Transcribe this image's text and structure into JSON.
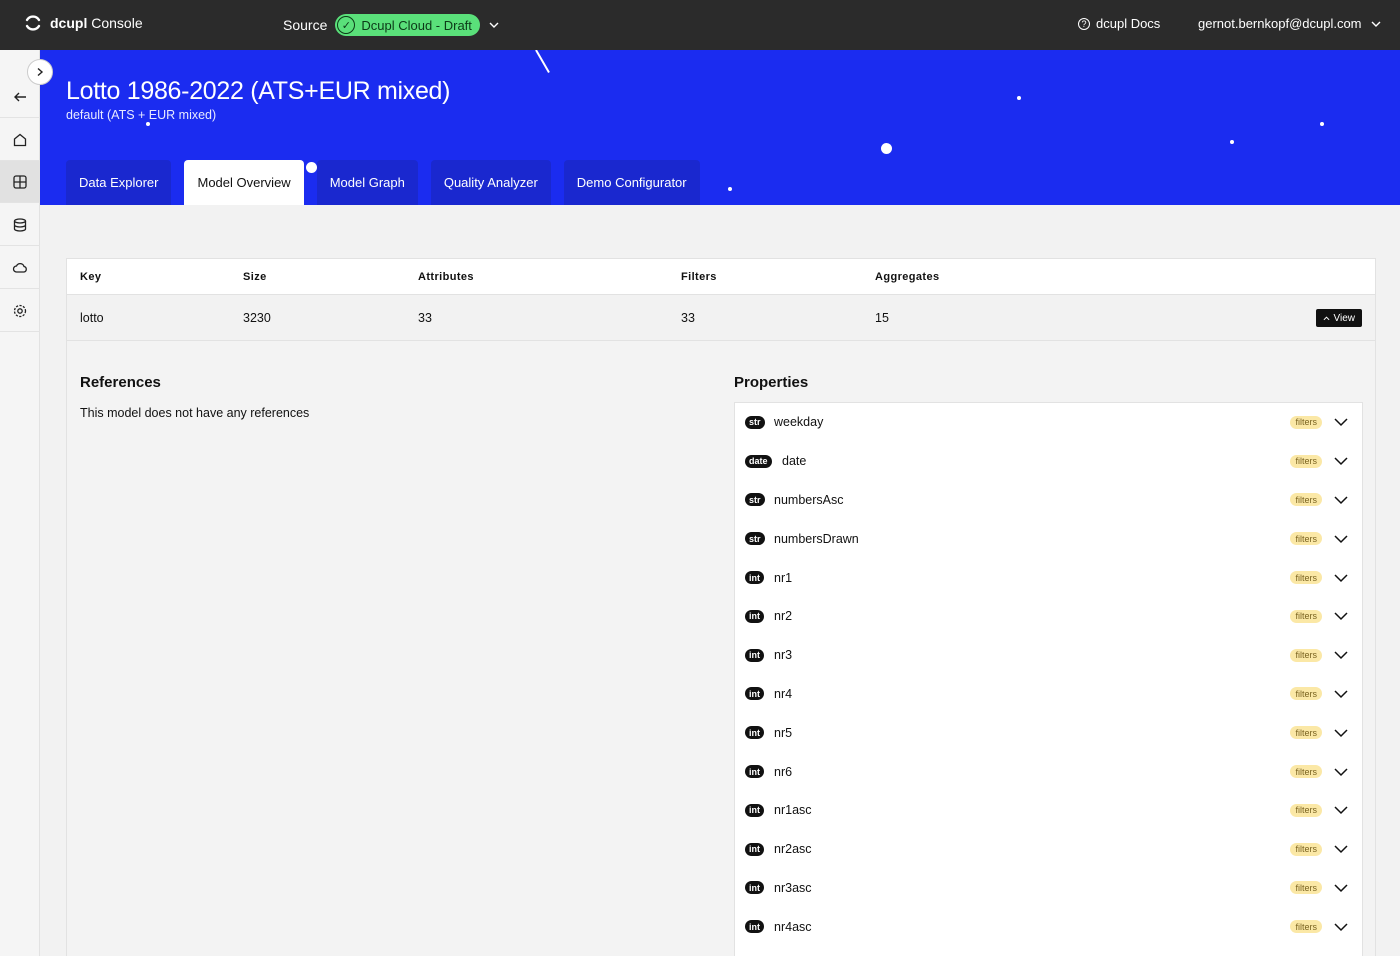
{
  "topbar": {
    "brand_bold": "dcupl",
    "brand_rest": " Console",
    "source_label": "Source",
    "source_value": "Dcupl Cloud - Draft",
    "docs_label": "dcupl Docs",
    "user_email": "gernot.bernkopf@dcupl.com"
  },
  "sidebar": {
    "items": [
      {
        "icon": "arrow-left-icon"
      },
      {
        "icon": "home-icon"
      },
      {
        "icon": "grid-icon"
      },
      {
        "icon": "database-icon"
      },
      {
        "icon": "cloud-icon"
      },
      {
        "icon": "gear-icon"
      }
    ]
  },
  "hero": {
    "title": "Lotto 1986-2022 (ATS+EUR mixed)",
    "subtitle": "default (ATS + EUR mixed)",
    "tabs": [
      {
        "label": "Data Explorer",
        "active": false
      },
      {
        "label": "Model Overview",
        "active": true
      },
      {
        "label": "Model Graph",
        "active": false
      },
      {
        "label": "Quality Analyzer",
        "active": false
      },
      {
        "label": "Demo Configurator",
        "active": false
      }
    ]
  },
  "table": {
    "headers": [
      "Key",
      "Size",
      "Attributes",
      "Filters",
      "Aggregates"
    ],
    "row": [
      "lotto",
      "3230",
      "33",
      "33",
      "15"
    ],
    "view_label": "View"
  },
  "references": {
    "title": "References",
    "empty_text": "This model does not have any references"
  },
  "properties": {
    "title": "Properties",
    "badge_label": "filters",
    "items": [
      {
        "type": "str",
        "name": "weekday"
      },
      {
        "type": "date",
        "name": "date"
      },
      {
        "type": "str",
        "name": "numbersAsc"
      },
      {
        "type": "str",
        "name": "numbersDrawn"
      },
      {
        "type": "int",
        "name": "nr1"
      },
      {
        "type": "int",
        "name": "nr2"
      },
      {
        "type": "int",
        "name": "nr3"
      },
      {
        "type": "int",
        "name": "nr4"
      },
      {
        "type": "int",
        "name": "nr5"
      },
      {
        "type": "int",
        "name": "nr6"
      },
      {
        "type": "int",
        "name": "nr1asc"
      },
      {
        "type": "int",
        "name": "nr2asc"
      },
      {
        "type": "int",
        "name": "nr3asc"
      },
      {
        "type": "int",
        "name": "nr4asc"
      }
    ]
  },
  "colors": {
    "hero_blue": "#1b2cf0",
    "topbar": "#2b2b2b",
    "source_green": "#5ae07a",
    "filters_yellow": "#fbe8a6"
  }
}
